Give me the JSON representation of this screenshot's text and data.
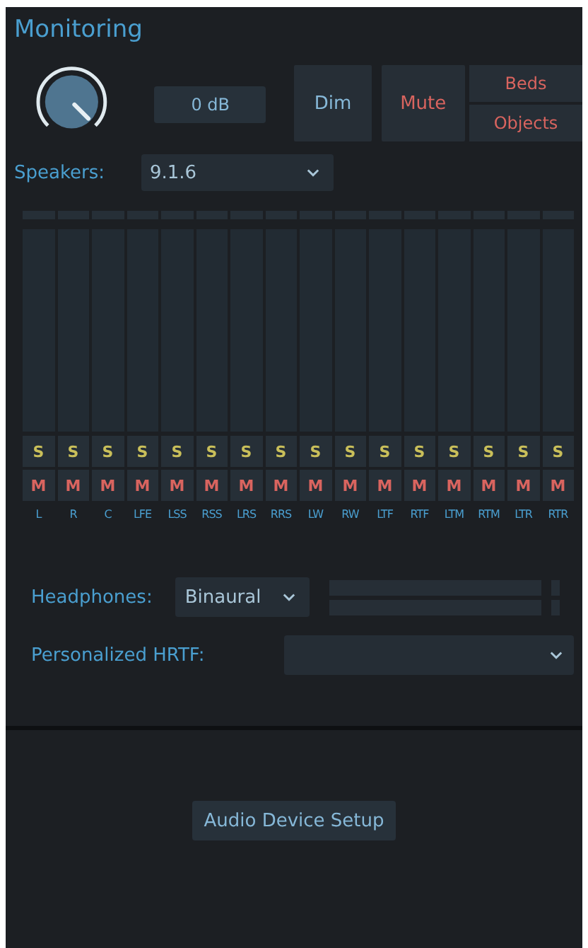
{
  "title": "Monitoring",
  "gain": {
    "reading": "0 dB"
  },
  "buttons": [
    {
      "label": "Dim",
      "kind": "dim"
    },
    {
      "label": "Mute",
      "kind": "mute"
    }
  ],
  "targets": [
    {
      "label": "Beds"
    },
    {
      "label": "Objects"
    }
  ],
  "speakers": {
    "label": "Speakers:",
    "value": "9.1.6"
  },
  "channels": [
    {
      "name": "L",
      "solo": "S",
      "mute": "M"
    },
    {
      "name": "R",
      "solo": "S",
      "mute": "M"
    },
    {
      "name": "C",
      "solo": "S",
      "mute": "M"
    },
    {
      "name": "LFE",
      "solo": "S",
      "mute": "M"
    },
    {
      "name": "LSS",
      "solo": "S",
      "mute": "M"
    },
    {
      "name": "RSS",
      "solo": "S",
      "mute": "M"
    },
    {
      "name": "LRS",
      "solo": "S",
      "mute": "M"
    },
    {
      "name": "RRS",
      "solo": "S",
      "mute": "M"
    },
    {
      "name": "LW",
      "solo": "S",
      "mute": "M"
    },
    {
      "name": "RW",
      "solo": "S",
      "mute": "M"
    },
    {
      "name": "LTF",
      "solo": "S",
      "mute": "M"
    },
    {
      "name": "RTF",
      "solo": "S",
      "mute": "M"
    },
    {
      "name": "LTM",
      "solo": "S",
      "mute": "M"
    },
    {
      "name": "RTM",
      "solo": "S",
      "mute": "M"
    },
    {
      "name": "LTR",
      "solo": "S",
      "mute": "M"
    },
    {
      "name": "RTR",
      "solo": "S",
      "mute": "M"
    }
  ],
  "headphones": {
    "label": "Headphones:",
    "value": "Binaural"
  },
  "hrtf": {
    "label": "Personalized HRTF:"
  },
  "setup_button": "Audio Device Setup"
}
